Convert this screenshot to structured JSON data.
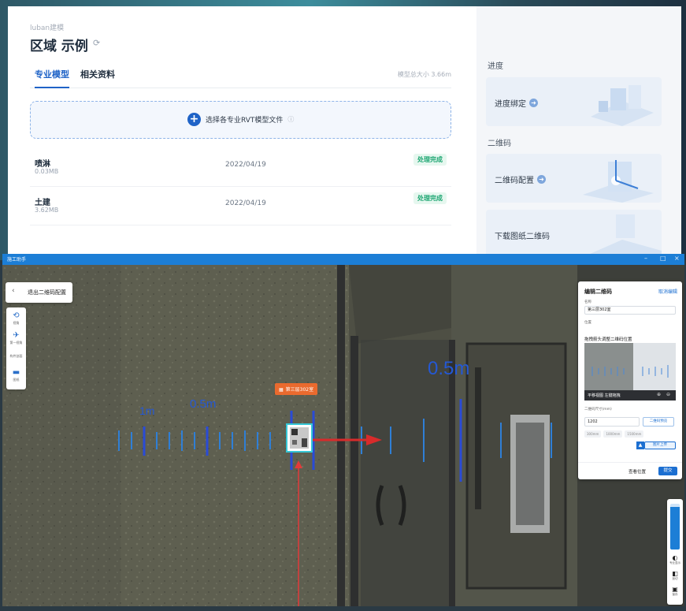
{
  "web": {
    "breadcrumb": "luban建模",
    "title": "区域 示例",
    "tabs": [
      {
        "label": "专业模型"
      },
      {
        "label": "相关资料"
      }
    ],
    "model_total_size": "模型总大小 3.66m",
    "upload_text": "选择各专业RVT模型文件",
    "files": [
      {
        "name": "喷淋",
        "size": "0.03MB",
        "date": "2022/04/19",
        "status": "处理完成"
      },
      {
        "name": "土建",
        "size": "3.62MB",
        "date": "2022/04/19",
        "status": "处理完成"
      }
    ],
    "sidebar": {
      "progress_section": "进度",
      "progress_bind": "进度绑定",
      "qr_section": "二维码",
      "qr_config": "二维码配置",
      "download_qr": "下载图纸二维码"
    }
  },
  "app": {
    "window_title": "施工助手",
    "exit_button": "退出二维码配置",
    "tools": [
      {
        "label": "视角",
        "icon": "rotate-icon"
      },
      {
        "label": "第一视角",
        "icon": "walk-icon"
      },
      {
        "label": "构件剖面",
        "icon": "section-icon"
      },
      {
        "label": "图纸",
        "icon": "folder-icon"
      }
    ],
    "scene": {
      "qr_label": "第三层302室",
      "dim_1m": "1m",
      "dim_05m_left": "0.5m",
      "dim_05m_right": "0.5m"
    },
    "edit_panel": {
      "title": "编辑二维码",
      "cancel": "取消编辑",
      "name_label": "名称",
      "name_value": "第三层302室",
      "position_label": "位置",
      "position_hint": "拖拽箭头调整二维码位置",
      "preview_tip": "平移视图 左键拖拽",
      "size_label": "二维码尺寸(mm)",
      "size_value": "1202",
      "qr_sample": "二维码预览",
      "presets": [
        "300mm",
        "1000mm",
        "1500mm"
      ],
      "upload_label": "图片上传",
      "view_button": "查看位置",
      "submit_button": "提交"
    },
    "right_tools": [
      {
        "label": "专业显示"
      },
      {
        "label": "剖切"
      },
      {
        "label": "保存"
      }
    ]
  },
  "colors": {
    "brand_blue": "#1c7ed6",
    "success_green": "#1ea672",
    "qr_tag_orange": "#ea6a2e",
    "dimension_blue": "#2458d4"
  }
}
